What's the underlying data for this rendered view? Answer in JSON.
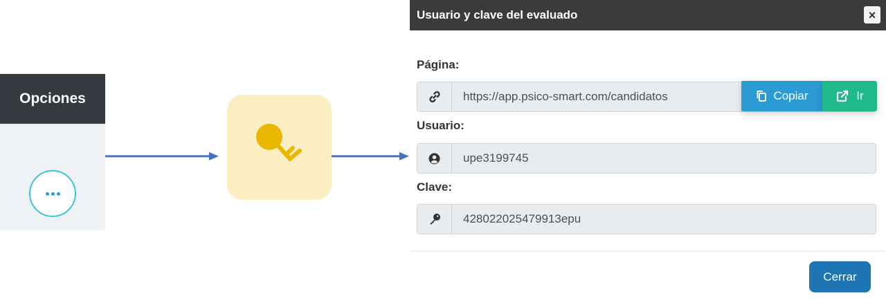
{
  "options": {
    "header": "Opciones"
  },
  "modal": {
    "title": "Usuario y clave del evaluado",
    "close_symbol": "×",
    "page_label": "Página:",
    "page_url": "https://app.psico-smart.com/candidatos",
    "copy_label": "Copiar",
    "go_label": "Ir",
    "user_label": "Usuario:",
    "user_value": "upe3199745",
    "password_label": "Clave:",
    "password_value": "428022025479913epu",
    "close_button": "Cerrar"
  },
  "icons": {
    "options_button": "ellipsis-icon",
    "tile": "key-icon",
    "page_addon": "link-icon",
    "copy": "copy-icon",
    "go": "external-link-icon",
    "user_addon": "user-circle-icon",
    "password_addon": "key-icon"
  },
  "colors": {
    "header_dark": "#343a40",
    "arrow": "#4472c4",
    "tile_bg": "#fbeec2",
    "key": "#e8b800",
    "copy_button": "#2b9bd6",
    "go_button": "#1fb98c",
    "close_button": "#1d75b3"
  }
}
